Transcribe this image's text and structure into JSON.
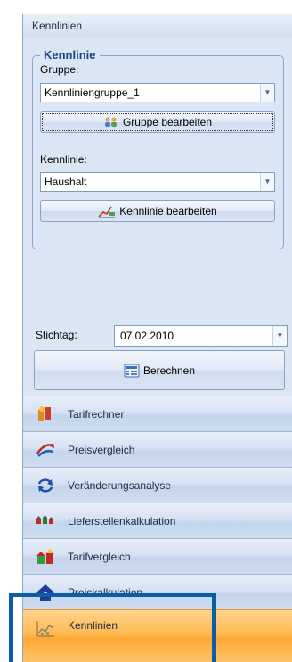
{
  "panel": {
    "title": "Kennlinien"
  },
  "kennlinie_group": {
    "legend": "Kennlinie",
    "gruppe_label": "Gruppe:",
    "gruppe_value": "Kennliniengruppe_1",
    "gruppe_button": "Gruppe bearbeiten",
    "kennlinie_label": "Kennlinie:",
    "kennlinie_value": "Haushalt",
    "kennlinie_button": "Kennlinie bearbeiten"
  },
  "stichtag": {
    "label": "Stichtag:",
    "value": "07.02.2010"
  },
  "berechnen_button": "Berechnen",
  "nav": [
    {
      "label": "Tarifrechner",
      "icon": "tarifrechner-icon"
    },
    {
      "label": "Preisvergleich",
      "icon": "preisvergleich-icon"
    },
    {
      "label": "Veränderungsanalyse",
      "icon": "veraenderungsanalyse-icon"
    },
    {
      "label": "Lieferstellenkalkulation",
      "icon": "lieferstellenkalkulation-icon"
    },
    {
      "label": "Tarifvergleich",
      "icon": "tarifvergleich-icon"
    },
    {
      "label": "Preiskalkulation",
      "icon": "preiskalkulation-icon"
    },
    {
      "label": "Kennlinien",
      "icon": "kennlinien-icon",
      "active": true
    }
  ],
  "colors": {
    "highlight_box": "#0a5ea8",
    "active_nav": "#ffb347",
    "panel_bg": "#dbe6f4"
  }
}
